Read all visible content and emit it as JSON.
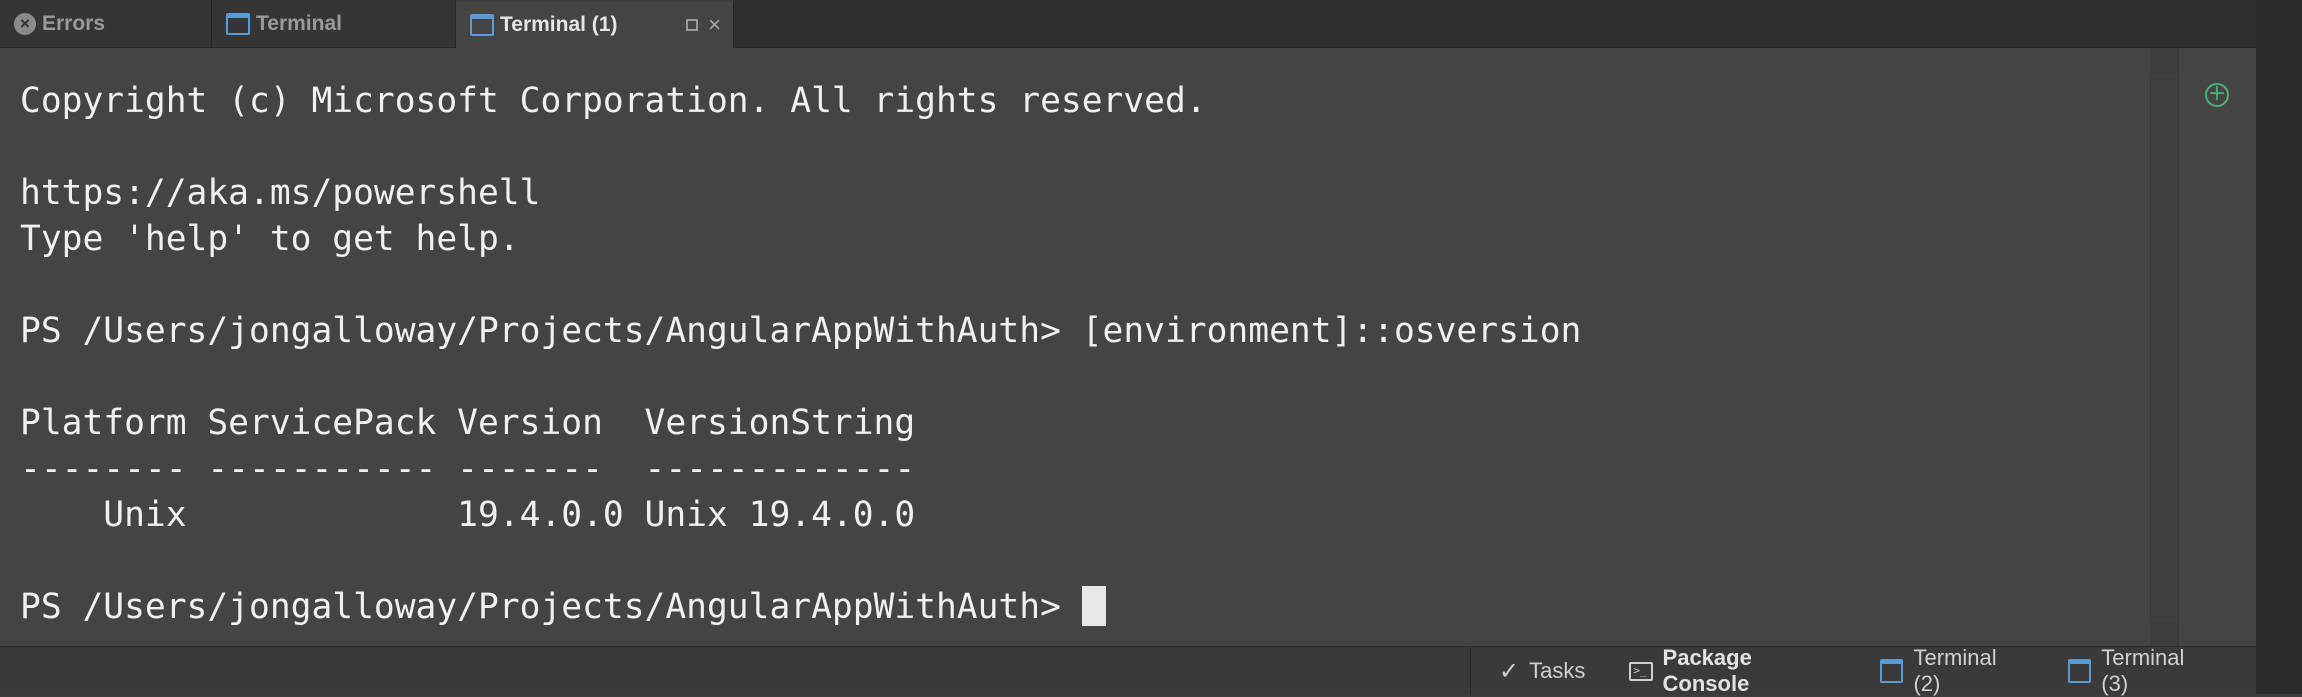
{
  "tabs": [
    {
      "label": "Errors",
      "icon": "error-circle-icon"
    },
    {
      "label": "Terminal",
      "icon": "terminal-window-icon"
    },
    {
      "label": "Terminal (1)",
      "icon": "terminal-window-icon",
      "active": true
    }
  ],
  "terminal": {
    "lines": [
      "Copyright (c) Microsoft Corporation. All rights reserved.",
      "",
      "https://aka.ms/powershell",
      "Type 'help' to get help.",
      "",
      "PS /Users/jongalloway/Projects/AngularAppWithAuth> [environment]::osversion",
      "",
      "Platform ServicePack Version  VersionString",
      "-------- ----------- -------  -------------",
      "    Unix             19.4.0.0 Unix 19.4.0.0",
      ""
    ],
    "prompt": "PS /Users/jongalloway/Projects/AngularAppWithAuth> "
  },
  "statusbar": {
    "tasks": "Tasks",
    "package_console": "Package Console",
    "terminal2": "Terminal (2)",
    "terminal3": "Terminal (3)"
  },
  "colors": {
    "terminal_bg": "#444444",
    "tab_bar_bg": "#2f2f2f",
    "accent_blue": "#5b9bd5",
    "add_green": "#4caf7a"
  }
}
